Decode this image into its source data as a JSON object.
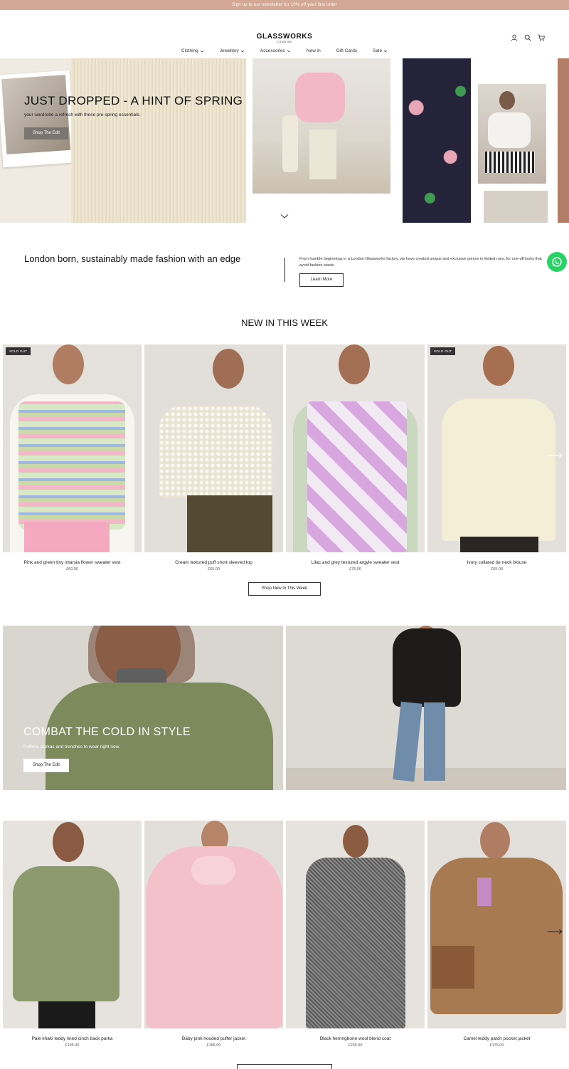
{
  "announcement": "Sign up to our newsletter for 10% off your first order",
  "brand": {
    "name": "GLASSWORKS",
    "sub": "LONDON"
  },
  "nav": [
    "Clothing",
    "Jewellery",
    "Accessories",
    "New in",
    "Gift Cards",
    "Sale"
  ],
  "icons": {
    "account": "user-icon",
    "search": "search-icon",
    "cart": "cart-icon"
  },
  "hero": {
    "title": "JUST DROPPED - A HINT OF SPRING",
    "subtitle": "your wardrobe a refresh with these pre-spring essentials.",
    "button": "Shop The Edit"
  },
  "intro": {
    "heading": "London born, sustainably made fashion with an edge",
    "text": "From humble beginnings in a London Glassworks factory, we have created unique and exclusive pieces in limited runs, for one-off looks that avoid fashion waste.",
    "button": "Learn More"
  },
  "new_in": {
    "title": "NEW IN THIS WEEK",
    "button": "Shop New In This Week",
    "products": [
      {
        "name": "Pink and green tiny intarsia flower sweater vest",
        "price": "£60.00",
        "badge": "SOLD OUT"
      },
      {
        "name": "Cream textured puff short sleeved top",
        "price": "£65.00",
        "badge": ""
      },
      {
        "name": "Lilac and grey textured argyle sweater vest",
        "price": "£75.00",
        "badge": ""
      },
      {
        "name": "Ivory collared tie neck blouse",
        "price": "£65.00",
        "badge": "SOLD OUT"
      }
    ]
  },
  "banner": {
    "title": "COMBAT THE COLD IN STYLE",
    "subtitle": "Puffers, parkas and trenches to wear right now.",
    "button": "Shop The Edit"
  },
  "outerwear": {
    "products": [
      {
        "name": "Pale khaki teddy lined cinch back parka",
        "price": "£195.00"
      },
      {
        "name": "Baby pink hooded puffer jacket",
        "price": "£165.00"
      },
      {
        "name": "Black herringbone wool blend coat",
        "price": "£295.00"
      },
      {
        "name": "Camel teddy patch pocket jacket",
        "price": "£175.00"
      }
    ]
  },
  "colors": {
    "announcement_bg": "#d3a996",
    "whatsapp": "#28d366",
    "badge_bg": "#333333"
  }
}
